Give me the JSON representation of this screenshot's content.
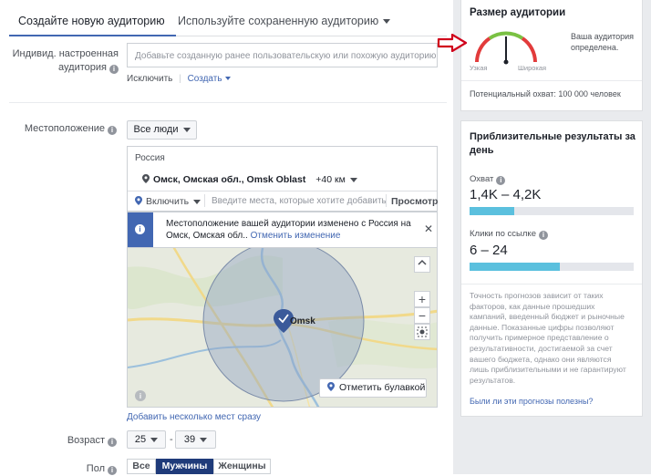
{
  "tabs": {
    "active": "Создайте новую аудиторию",
    "other": "Используйте сохраненную аудиторию"
  },
  "custom_audience": {
    "label_line1": "Индивид. настроенная",
    "label_line2": "аудитория",
    "placeholder": "Добавьте созданную ранее пользовательскую или похожую аудиторию",
    "exclude": "Исключить",
    "create": "Создать"
  },
  "location": {
    "label": "Местоположение",
    "people_dropdown": "Все люди",
    "country": "Россия",
    "place": "Омск, Омская обл., Omsk Oblast",
    "radius": "+40 км",
    "include": "Включить",
    "search_placeholder": "Введите места, которые хотите добавить",
    "browse": "Просмотр",
    "notice_line1": "Местоположение вашей аудитории изменено с Россия на",
    "notice_line2_prefix": "Омск, Омская обл..",
    "notice_undo": "Отменить изменение",
    "map_city": "Omsk",
    "pin_button": "Отметить булавкой",
    "add_multiple": "Добавить несколько мест сразу"
  },
  "age": {
    "label": "Возраст",
    "min": "25",
    "separator": "-",
    "max": "39"
  },
  "gender": {
    "label": "Пол",
    "options": [
      "Все",
      "Мужчины",
      "Женщины"
    ],
    "selected": "Мужчины"
  },
  "audience_size": {
    "title": "Размер аудитории",
    "narrow": "Узкая",
    "broad": "Широкая",
    "status_line1": "Ваша аудитория",
    "status_line2": "определена.",
    "potential_reach": "Потенциальный охват: 100 000 человек",
    "gauge_level": 0.5
  },
  "estimates": {
    "title_line1": "Приблизительные результаты за",
    "title_line2": "день",
    "reach_label": "Охват",
    "reach_value": "1,4K – 4,2K",
    "reach_fill": 0.27,
    "clicks_label": "Клики по ссылке",
    "clicks_value": "6 – 24",
    "clicks_fill": 0.55,
    "disclaimer": [
      "Точность прогнозов зависит от таких",
      "факторов, как данные прошедших",
      "кампаний, введенный бюджет и рыночные",
      "данные. Показанные цифры позволяют",
      "получить примерное представление о",
      "результативности, достигаемой за счет",
      "вашего бюджета, однако они являются",
      "лишь приблизительными и не гарантируют",
      "результатов."
    ],
    "feedback_link": "Были ли эти прогнозы полезны?"
  },
  "colors": {
    "brand": "#4267b2",
    "bar": "#5bc0de",
    "arrow": "#d0021b"
  }
}
